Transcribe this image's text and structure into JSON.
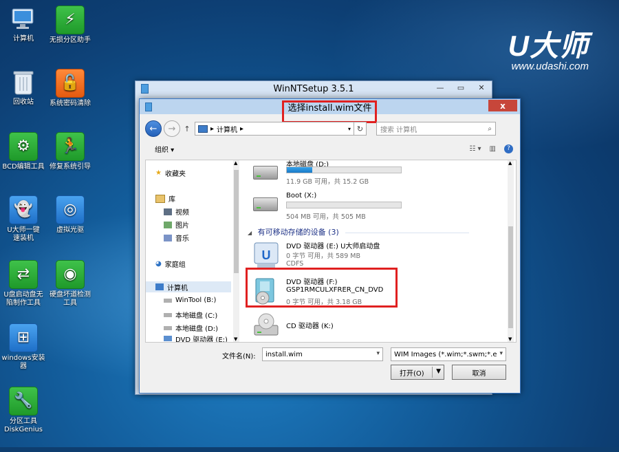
{
  "desktop": {
    "icons": [
      {
        "label": "计算机",
        "icon": "computer-icon"
      },
      {
        "label": "无损分区助手",
        "icon": "partition-assistant-icon"
      },
      {
        "label": "回收站",
        "icon": "recycle-bin-icon"
      },
      {
        "label": "系统密码清除",
        "icon": "password-clear-icon"
      },
      {
        "label": "BCD编辑工具",
        "icon": "bcd-gear-icon"
      },
      {
        "label": "修复系统引导",
        "icon": "repair-boot-icon"
      },
      {
        "label": "U大师一键快速装机",
        "icon": "ghost-icon"
      },
      {
        "label": "虚拟光驱",
        "icon": "virtual-drive-icon"
      },
      {
        "label": "U盘启动盘无陷制作工具",
        "icon": "usb-tool-icon"
      },
      {
        "label": "硬盘坏道检测工具",
        "icon": "disk-check-icon"
      },
      {
        "label": "windows安装器",
        "icon": "windows-installer-icon"
      },
      {
        "label": "分区工具DiskGenius",
        "icon": "diskgenius-icon"
      }
    ],
    "labels_split": {
      "ghost_line1": "U大师一键",
      "ghost_line2": "速装机",
      "usb_line1": "U盘启动盘无",
      "usb_line2": "陷制作工具",
      "disk_line1": "硬盘坏道检测",
      "disk_line2": "工具",
      "win_line1": "windows安装",
      "win_line2": "器",
      "dg_line1": "分区工具",
      "dg_line2": "DiskGenius"
    }
  },
  "logo": {
    "main": "U大师",
    "url": "www.udashi.com"
  },
  "back_window": {
    "title": "WinNTSetup 3.5.1"
  },
  "dialog": {
    "title": "选择install.wim文件",
    "close": "x",
    "address": "计算机",
    "search_placeholder": "搜索 计算机",
    "organize": "组织 ▾",
    "nav": {
      "favorites": "收藏夹",
      "libraries": "库",
      "videos": "视频",
      "pictures": "图片",
      "music": "音乐",
      "homegroup": "家庭组",
      "computer": "计算机",
      "drives": [
        "WinTool (B:)",
        "本地磁盘 (C:)",
        "本地磁盘 (D:)",
        "DVD 驱动器 (E:)"
      ]
    },
    "files": {
      "local_d": {
        "name": "本地磁盘 (D:)",
        "size": "11.9 GB 可用，共 15.2 GB",
        "used_fraction": 0.22
      },
      "boot_x": {
        "name": "Boot (X:)",
        "size": "504 MB 可用，共 505 MB",
        "used_fraction": 0.0
      },
      "removable_header": "有可移动存储的设备 (3)",
      "dvd_e": {
        "name": "DVD 驱动器 (E:) U大师启动盘",
        "size": "0 字节 可用，共 589 MB",
        "fs": "CDFS"
      },
      "dvd_f": {
        "name": "DVD 驱动器 (F:)",
        "label": "GSP1RMCULXFRER_CN_DVD",
        "size": "0 字节 可用，共 3.18 GB"
      },
      "cd_k": {
        "name": "CD 驱动器 (K:)"
      }
    },
    "filename_label": "文件名(N):",
    "filename_value": "install.wim",
    "filetype_value": "WIM Images (*.wim;*.swm;*.e",
    "open_button": "打开(O)",
    "cancel_button": "取消"
  }
}
